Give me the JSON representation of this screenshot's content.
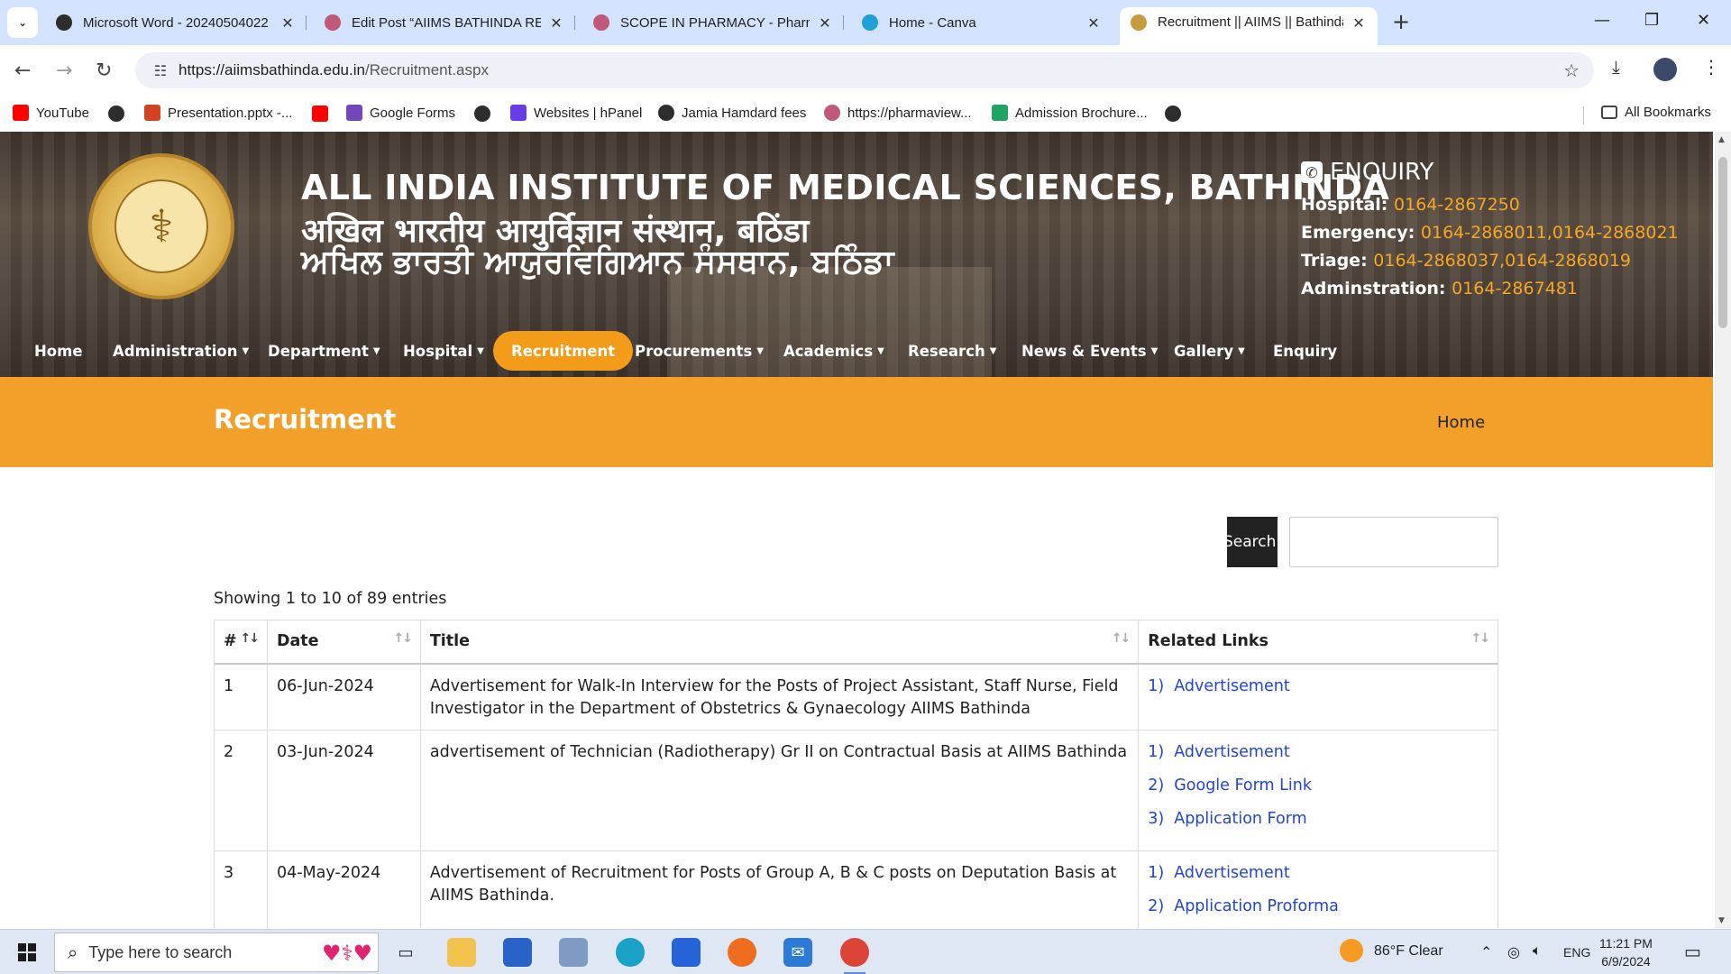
{
  "browser": {
    "tabs": [
      {
        "title": "Microsoft Word - 20240504022",
        "color": "#2d2d2d"
      },
      {
        "title": "Edit Post “AIIMS BATHINDA REC",
        "color": "#c0587a"
      },
      {
        "title": "SCOPE IN PHARMACY - Pharma",
        "color": "#c0587a"
      },
      {
        "title": "Home - Canva",
        "color": "#1fa0d8"
      },
      {
        "title": "Recruitment || AIIMS || Bathinda",
        "color": "#c79a3c"
      }
    ],
    "url_host": "https://aiimsbathinda.edu.in",
    "url_path": "/Recruitment.aspx",
    "bookmarks": [
      {
        "label": "YouTube",
        "color": "#ff0000"
      },
      {
        "label": "Presentation.pptx -...",
        "color": "#d04423"
      },
      {
        "label": "Google Forms",
        "color": "#7248b9"
      },
      {
        "label": "Websites | hPanel",
        "color": "#673de6"
      },
      {
        "label": "Jamia Hamdard fees",
        "color": "#2d2d2d"
      },
      {
        "label": "https://pharmaview...",
        "color": "#c0587a"
      },
      {
        "label": "Admission Brochure...",
        "color": "#1fa463"
      }
    ],
    "all_bookmarks": "All Bookmarks"
  },
  "site": {
    "title_en": "ALL INDIA INSTITUTE OF MEDICAL SCIENCES, BATHINDA",
    "title_hi": "अखिल भारतीय आयुर्विज्ञान संस्थान, बठिंडा",
    "title_pa": "ਅਖਿਲ ਭਾਰਤੀ ਆਯੁਰਵਿਗਿਆਨ ਸੰਸਥਾਨ, ਬਠਿੰਡਾ",
    "enquiry": {
      "heading": "ENQUIRY",
      "rows": [
        {
          "label": "Hospital:",
          "value": "0164-2867250"
        },
        {
          "label": "Emergency:",
          "value": "0164-2868011,0164-2868021"
        },
        {
          "label": "Triage:",
          "value": "0164-2868037,0164-2868019"
        },
        {
          "label": "Adminstration:",
          "value": "0164-2867481"
        }
      ]
    },
    "nav": [
      {
        "label": "Home",
        "dropdown": false
      },
      {
        "label": "Administration",
        "dropdown": true
      },
      {
        "label": "Department",
        "dropdown": true
      },
      {
        "label": "Hospital",
        "dropdown": true
      },
      {
        "label": "Recruitment",
        "dropdown": false,
        "active": true
      },
      {
        "label": "Procurements",
        "dropdown": true
      },
      {
        "label": "Academics",
        "dropdown": true
      },
      {
        "label": "Research",
        "dropdown": true
      },
      {
        "label": "News & Events",
        "dropdown": true
      },
      {
        "label": "Gallery",
        "dropdown": true
      },
      {
        "label": "Enquiry",
        "dropdown": false
      }
    ],
    "accent": "#f39c1a"
  },
  "page": {
    "heading": "Recruitment",
    "breadcrumb": "Home",
    "search_label": "Search:",
    "search_value": "",
    "showing": "Showing 1 to 10 of 89 entries",
    "columns": [
      "#",
      "Date",
      "Title",
      "Related Links"
    ],
    "rows": [
      {
        "num": "1",
        "date": "06-Jun-2024",
        "title": "Advertisement for Walk-In Interview for the Posts of Project Assistant, Staff Nurse, Field Investigator in the Department of Obstetrics & Gynaecology AIIMS Bathinda",
        "links": [
          {
            "n": "1)",
            "label": "Advertisement"
          }
        ]
      },
      {
        "num": "2",
        "date": "03-Jun-2024",
        "title": "advertisement of Technician (Radiotherapy) Gr II on Contractual Basis at AIIMS Bathinda",
        "links": [
          {
            "n": "1)",
            "label": "Advertisement"
          },
          {
            "n": "2)",
            "label": "Google Form Link"
          },
          {
            "n": "3)",
            "label": "Application Form"
          }
        ]
      },
      {
        "num": "3",
        "date": "04-May-2024",
        "title": "Advertisement of Recruitment for Posts of Group A, B & C posts on Deputation Basis at AIIMS Bathinda.",
        "links": [
          {
            "n": "1)",
            "label": "Advertisement"
          },
          {
            "n": "2)",
            "label": "Application Proforma"
          }
        ]
      }
    ]
  },
  "taskbar": {
    "search_placeholder": "Type here to search",
    "weather": "86°F  Clear",
    "lang": "ENG",
    "time": "11:21 PM",
    "date": "6/9/2024"
  }
}
